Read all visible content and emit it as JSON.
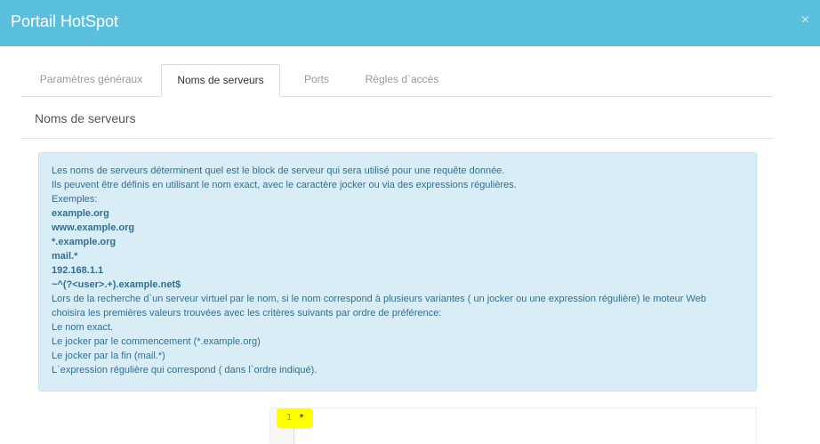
{
  "window": {
    "title": "Portail HotSpot",
    "close_symbol": "×"
  },
  "tabs": [
    {
      "label": "Paramètres généraux",
      "active": false
    },
    {
      "label": "Noms de serveurs",
      "active": true
    },
    {
      "label": "Ports",
      "active": false
    },
    {
      "label": "Règles d`accès",
      "active": false
    }
  ],
  "section": {
    "title": "Noms de serveurs"
  },
  "info": {
    "lines": [
      "Les noms de serveurs déterminent quel est le block de serveur qui sera utilisé pour une requête donnée.",
      "Ils peuvent être définis en utilisant le nom exact, avec le caractère jocker ou via des expressions régulières.",
      "Exemples:",
      "example.org",
      "www.example.org",
      "*.example.org",
      "mail.*",
      "192.168.1.1",
      "~^(?<user>.+).example.net$",
      "Lors de la recherche d`un serveur virtuel par le nom, si le nom correspond à plusieurs variantes ( un jocker ou une expression régulière) le moteur Web",
      "choisira les premières valeurs trouvées avec les critères suivants par ordre de préférence:",
      "Le nom exact.",
      "Le jocker par le commencement (*.example.org)",
      "Le jocker par la fin (mail.*)",
      "L`expression régulière qui correspond ( dans l`ordre indiqué)."
    ]
  },
  "editor": {
    "line_number": "1",
    "content": "*",
    "highlight_color": "#ffff00"
  },
  "colors": {
    "header": "#5bc0de",
    "info_bg": "#d9edf7",
    "info_text": "#31708f"
  }
}
